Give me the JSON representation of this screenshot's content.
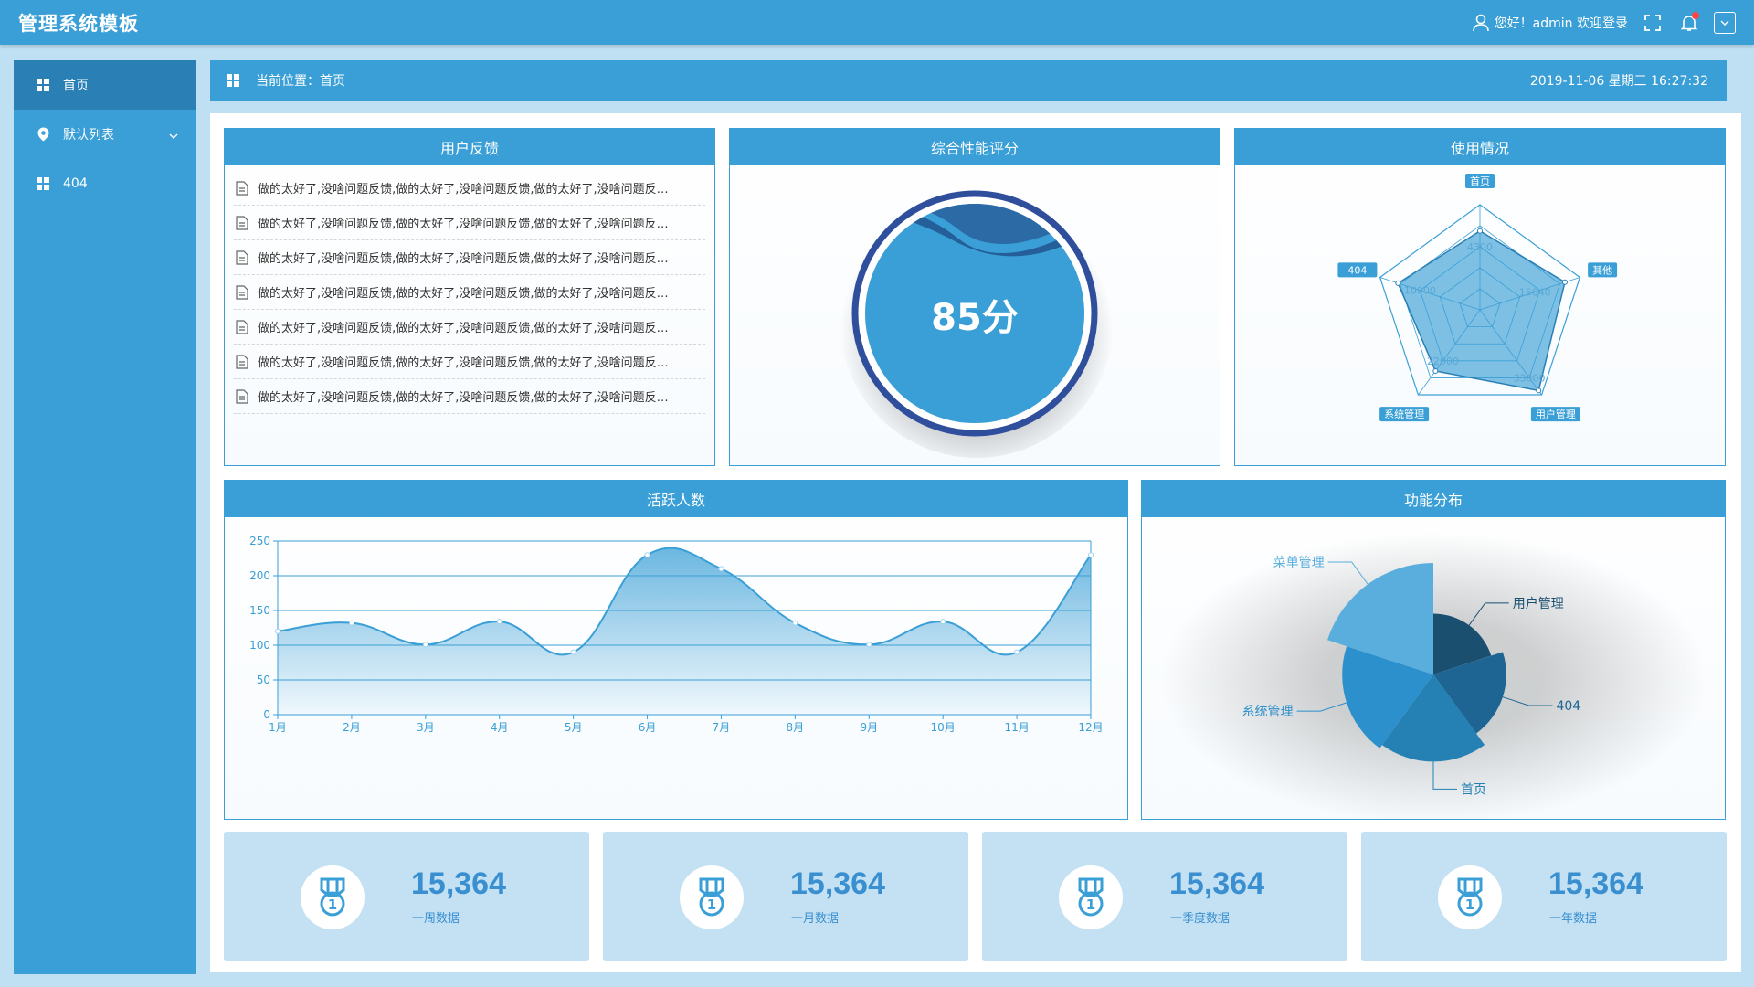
{
  "header": {
    "title": "管理系统模板",
    "greeting": "您好！admin 欢迎登录"
  },
  "sidebar": {
    "items": [
      {
        "label": "首页"
      },
      {
        "label": "默认列表"
      },
      {
        "label": "404"
      }
    ]
  },
  "breadcrumb": {
    "label": "当前位置：首页",
    "datetime": "2019-11-06 星期三 16:27:32"
  },
  "feedback": {
    "title": "用户反馈",
    "items": [
      "做的太好了,没啥问题反馈,做的太好了,没啥问题反馈,做的太好了,没啥问题反…",
      "做的太好了,没啥问题反馈,做的太好了,没啥问题反馈,做的太好了,没啥问题反…",
      "做的太好了,没啥问题反馈,做的太好了,没啥问题反馈,做的太好了,没啥问题反…",
      "做的太好了,没啥问题反馈,做的太好了,没啥问题反馈,做的太好了,没啥问题反…",
      "做的太好了,没啥问题反馈,做的太好了,没啥问题反馈,做的太好了,没啥问题反…",
      "做的太好了,没啥问题反馈,做的太好了,没啥问题反馈,做的太好了,没啥问题反…",
      "做的太好了,没啥问题反馈,做的太好了,没啥问题反馈,做的太好了,没啥问题反…"
    ]
  },
  "score": {
    "title": "综合性能评分",
    "value": "85分"
  },
  "usage": {
    "title": "使用情况"
  },
  "active_chart_title": "活跃人数",
  "func_chart_title": "功能分布",
  "stats": [
    {
      "value": "15,364",
      "label": "一周数据"
    },
    {
      "value": "15,364",
      "label": "一月数据"
    },
    {
      "value": "15,364",
      "label": "一季度数据"
    },
    {
      "value": "15,364",
      "label": "一年数据"
    }
  ],
  "colors": {
    "primary": "#3a9fd6",
    "dark": "#2a7fb4",
    "stat_bg": "#c3e1f3"
  },
  "chart_data": [
    {
      "type": "radar",
      "indicators": [
        "首页",
        "其他",
        "用户管理",
        "系统管理",
        "404"
      ],
      "axis_values": [
        "4300",
        "15640",
        "33000",
        "22000",
        "10000"
      ],
      "values": [
        0.75,
        0.85,
        0.95,
        0.72,
        0.82
      ]
    },
    {
      "type": "area",
      "categories": [
        "1月",
        "2月",
        "3月",
        "4月",
        "5月",
        "6月",
        "7月",
        "8月",
        "9月",
        "10月",
        "11月",
        "12月"
      ],
      "values": [
        120,
        132,
        101,
        134,
        90,
        230,
        210,
        132,
        101,
        134,
        90,
        230
      ],
      "ylim": [
        0,
        250
      ],
      "yticks": [
        0,
        50,
        100,
        150,
        200,
        250
      ],
      "grid": true
    },
    {
      "type": "pie",
      "style": "rose",
      "labels": [
        "用户管理",
        "404",
        "首页",
        "系统管理",
        "菜单管理"
      ],
      "values": [
        60,
        72,
        86,
        90,
        110
      ],
      "colors": [
        "#1a4f70",
        "#1e6593",
        "#2580b4",
        "#2c90cc",
        "#5aaede"
      ]
    }
  ]
}
